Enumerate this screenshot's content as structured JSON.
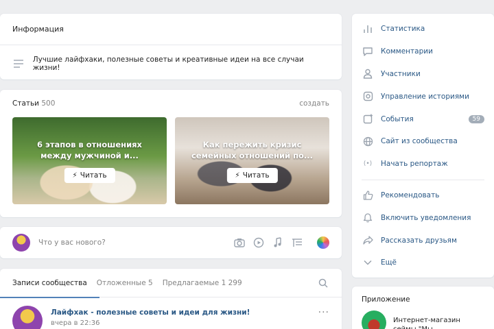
{
  "info": {
    "header": "Информация",
    "description": "Лучшие лайфхаки, полезные советы и креативные идеи на все случаи жизни!"
  },
  "articles": {
    "label": "Статьи",
    "count": "500",
    "create": "создать",
    "tiles": [
      {
        "title": "6 этапов в отношениях между мужчиной и...",
        "read": "Читать"
      },
      {
        "title": "Как пережить кризис семейных отношений по...",
        "read": "Читать"
      }
    ]
  },
  "composer": {
    "placeholder": "Что у вас нового?"
  },
  "tabs": {
    "posts": "Записи сообщества",
    "postponed_label": "Отложенные",
    "postponed_count": "5",
    "suggested_label": "Предлагаемые",
    "suggested_count": "1 299"
  },
  "post": {
    "author": "Лайфхак - полезные советы и идеи для жизни!",
    "time": "вчера в 22:36"
  },
  "sidebar": {
    "items": [
      {
        "label": "Статистика",
        "icon": "stats-icon"
      },
      {
        "label": "Комментарии",
        "icon": "comments-icon"
      },
      {
        "label": "Участники",
        "icon": "members-icon"
      },
      {
        "label": "Управление историями",
        "icon": "stories-icon"
      },
      {
        "label": "События",
        "icon": "events-icon",
        "badge": "59"
      },
      {
        "label": "Сайт из сообщества",
        "icon": "globe-icon"
      },
      {
        "label": "Начать репортаж",
        "icon": "live-icon"
      }
    ],
    "actions": [
      {
        "label": "Рекомендовать",
        "icon": "like-icon"
      },
      {
        "label": "Включить уведомления",
        "icon": "bell-icon"
      },
      {
        "label": "Рассказать друзьям",
        "icon": "share-icon"
      },
      {
        "label": "Ещё",
        "icon": "chevron-down-icon"
      }
    ]
  },
  "app": {
    "header": "Приложение",
    "title": "Интернет-магазин сеймы \"Мы"
  },
  "colors": {
    "accent": "#5181b8",
    "link": "#2a5885",
    "background": "#edeef0"
  }
}
